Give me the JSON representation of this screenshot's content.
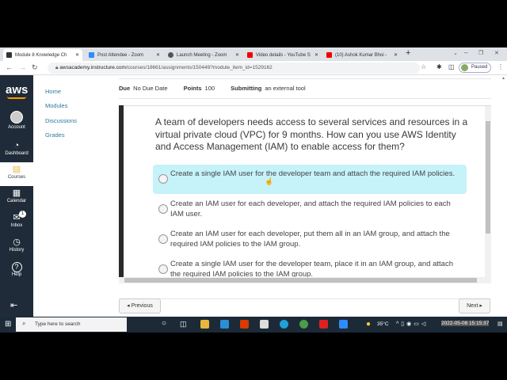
{
  "browser": {
    "tabs": [
      {
        "title": "Module 8 Knowledge Ch",
        "active": true,
        "color": "#333"
      },
      {
        "title": "Post Attendee - Zoom",
        "active": false,
        "color": "#2d8cff"
      },
      {
        "title": "Launch Meeting - Zoom",
        "active": false,
        "color": "#555"
      },
      {
        "title": "Video details - YouTube S",
        "active": false,
        "color": "#e00"
      },
      {
        "title": "(10) Ashok Kumar Bhoi -",
        "active": false,
        "color": "#e00"
      }
    ],
    "url_host": "awsacademy.instructure.com",
    "url_path": "/courses/18661/assignments/150449?module_item_id=1529162",
    "profile_status": "Paused"
  },
  "global_nav": [
    {
      "label": "Account",
      "icon": "account-icon",
      "glyph": "●"
    },
    {
      "label": "Dashboard",
      "icon": "dashboard-icon",
      "glyph": "◔"
    },
    {
      "label": "Courses",
      "icon": "courses-icon",
      "glyph": "▤",
      "active": true
    },
    {
      "label": "Calendar",
      "icon": "calendar-icon",
      "glyph": "▦"
    },
    {
      "label": "Inbox",
      "icon": "inbox-icon",
      "glyph": "✉",
      "badge": "1"
    },
    {
      "label": "History",
      "icon": "history-icon",
      "glyph": "◷"
    },
    {
      "label": "Help",
      "icon": "help-icon",
      "glyph": "?"
    }
  ],
  "logo": "aws",
  "course_nav": [
    "Home",
    "Modules",
    "Discussions",
    "Grades"
  ],
  "meta": {
    "due_label": "Due",
    "due_value": "No Due Date",
    "points_label": "Points",
    "points_value": "100",
    "submitting_label": "Submitting",
    "submitting_value": "an external tool"
  },
  "quiz": {
    "question": "A team of developers needs access to several services and resources in a virtual private cloud (VPC) for 9 months. How can you use AWS Identity and Access Management (IAM) to enable access for them?",
    "options": [
      "Create a single IAM user for the developer team and attach the required IAM policies.",
      "Create an IAM user for each developer, and attach the required IAM policies to each IAM user.",
      "Create an IAM user for each developer, put them all in an IAM group, and attach the required IAM policies to the IAM group.",
      "Create a single IAM user for the developer team, place it in an IAM group, and attach the required IAM policies to the IAM group."
    ]
  },
  "pager": {
    "previous": "◂ Previous",
    "next": "Next ▸"
  },
  "taskbar": {
    "search_placeholder": "Type here to search",
    "weather": "35°C",
    "clock": "2022-05-08 15:15:37"
  }
}
